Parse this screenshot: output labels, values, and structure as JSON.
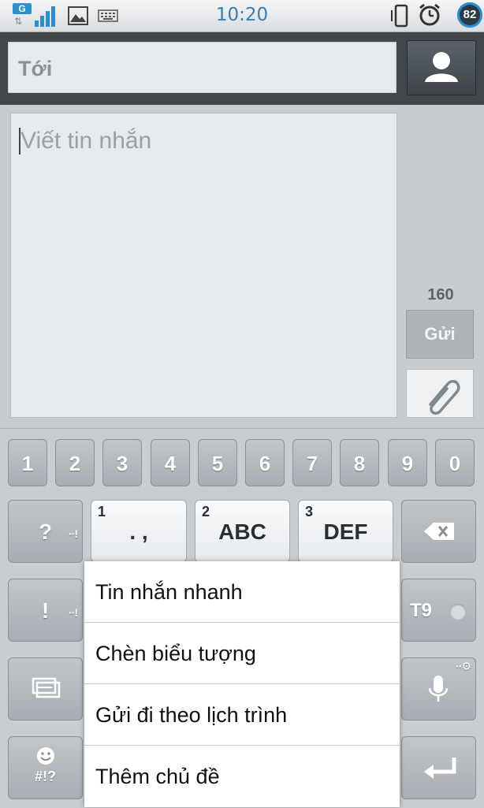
{
  "status_bar": {
    "network": "G",
    "time": "10:20",
    "battery": "82"
  },
  "recipient": {
    "placeholder": "Tới"
  },
  "compose": {
    "placeholder": "Viết tin nhắn",
    "char_count": "160",
    "send_label": "Gửi"
  },
  "keyboard": {
    "number_row": [
      "1",
      "2",
      "3",
      "4",
      "5",
      "6",
      "7",
      "8",
      "9",
      "0"
    ],
    "question_key": "?",
    "exclaim_key": "!",
    "key_punct": {
      "sub": "1",
      "main": ". ,"
    },
    "key_abc": {
      "sub": "2",
      "main": "ABC"
    },
    "key_def": {
      "sub": "3",
      "main": "DEF"
    },
    "t9_label": "T9",
    "symbol_key_label": "#!?"
  },
  "popup_menu": {
    "items": [
      "Tin nhắn nhanh",
      "Chèn biểu tượng",
      "Gửi đi theo lịch trình",
      "Thêm chủ đề"
    ]
  },
  "colors": {
    "accent": "#2b8fcf",
    "header_dark": "#42474c"
  }
}
